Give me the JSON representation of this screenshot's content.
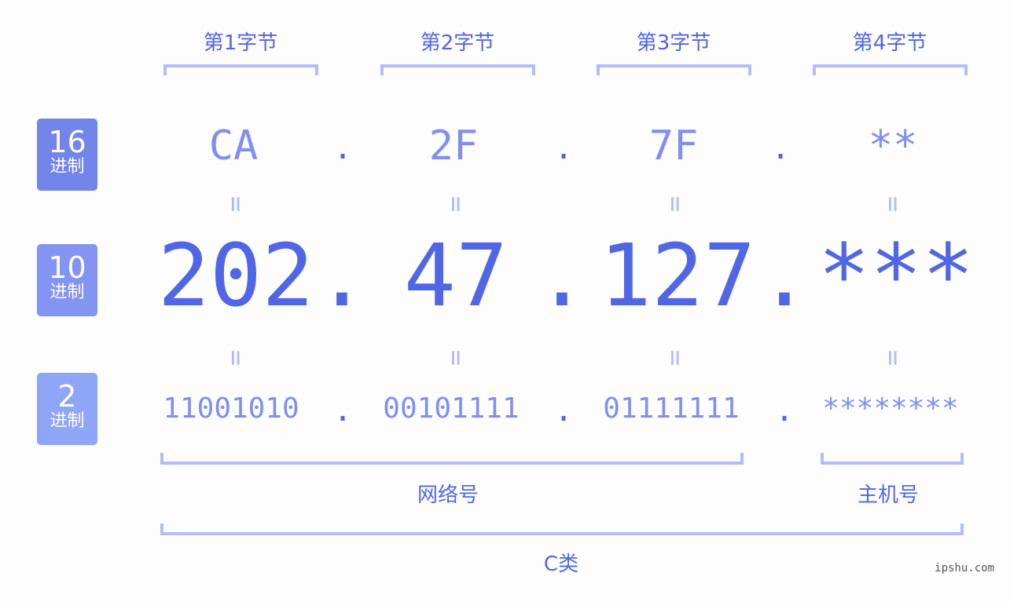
{
  "byte_labels": [
    "第1字节",
    "第2字节",
    "第3字节",
    "第4字节"
  ],
  "badges": [
    {
      "num": "16",
      "label": "进制",
      "color": "#7384ea"
    },
    {
      "num": "10",
      "label": "进制",
      "color": "#8394f2"
    },
    {
      "num": "2",
      "label": "进制",
      "color": "#8fa6f8"
    }
  ],
  "hex": [
    "CA",
    "2F",
    "7F",
    "**"
  ],
  "decimal": [
    "202",
    "47",
    "127",
    "***"
  ],
  "binary": [
    "11001010",
    "00101111",
    "01111111",
    "********"
  ],
  "separator": ".",
  "equals": "=",
  "network_label": "网络号",
  "host_label": "主机号",
  "class_label": "C类",
  "watermark": "ipshu.com"
}
